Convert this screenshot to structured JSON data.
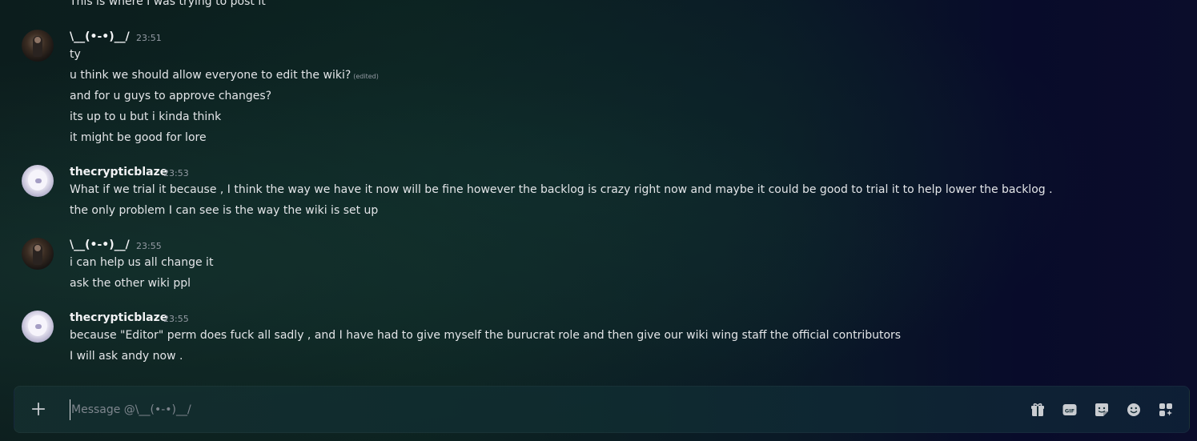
{
  "recipient": "\\__(•-•)__/",
  "messages": [
    {
      "lines": [
        "This is where I was trying to post it"
      ]
    },
    {
      "author": "\\__(•-•)__/",
      "time": "23:51",
      "lines": [
        "ty",
        "u think we should allow everyone to edit the wiki?",
        "and for u guys to approve changes?",
        "its up to u but i kinda think",
        "it might be good for lore"
      ],
      "edited_tag": "(edited)"
    },
    {
      "author": "thecrypticblaze",
      "time": "23:53",
      "lines": [
        "What if we trial it because , I think the way we have it now will be fine however the backlog is crazy right now and maybe it could be good to trial it to help lower the backlog .",
        "the only problem I can see is the way the wiki is set up"
      ]
    },
    {
      "author": "\\__(•-•)__/",
      "time": "23:55",
      "lines": [
        "i can help us all change it",
        "ask the other wiki ppl"
      ]
    },
    {
      "author": "thecrypticblaze",
      "time": "23:55",
      "lines": [
        "because \"Editor\" perm does fuck all sadly , and I have had to give myself the burucrat role and then give our wiki wing staff the official contributors",
        "I will ask andy now ."
      ]
    }
  ],
  "composer": {
    "placeholder": "Message @\\__(•-•)__/",
    "icons": [
      "plus-icon",
      "gift-icon",
      "gif-icon",
      "sticker-icon",
      "emoji-icon",
      "apps-icon"
    ]
  },
  "colors": {
    "text": "#dfe3e6",
    "timestamp": "#949ba4",
    "username": "#f2f3f5"
  }
}
